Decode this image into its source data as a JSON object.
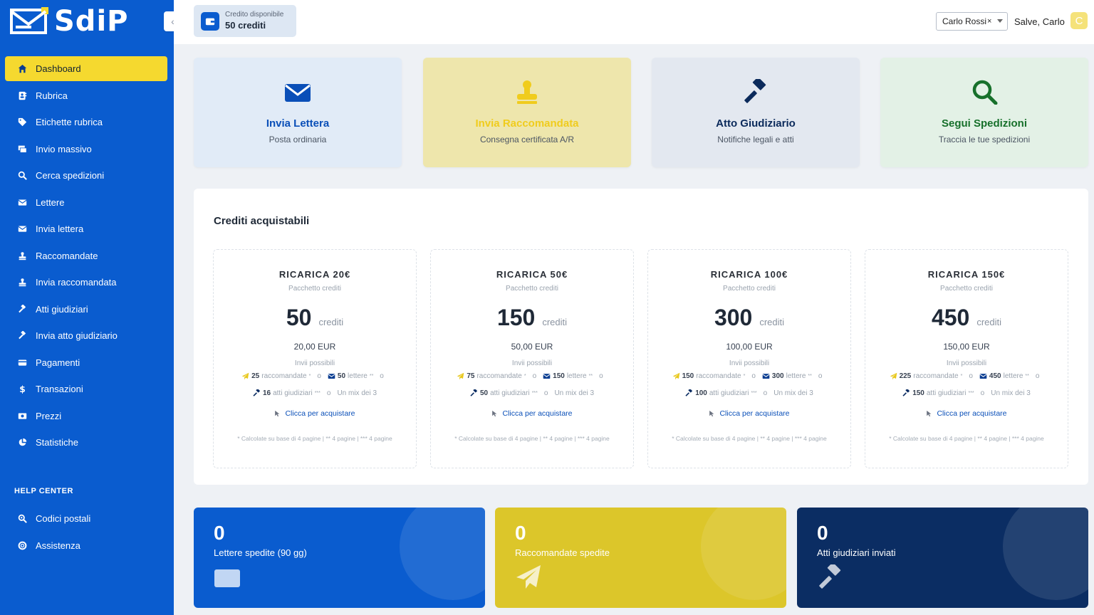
{
  "app": {
    "name": "SdiP"
  },
  "sidebar": {
    "items": [
      {
        "label": "Dashboard",
        "icon": "home-icon",
        "active": true
      },
      {
        "label": "Rubrica",
        "icon": "address-book-icon"
      },
      {
        "label": "Etichette rubrica",
        "icon": "tag-icon"
      },
      {
        "label": "Invio massivo",
        "icon": "mass-mail-icon"
      },
      {
        "label": "Cerca spedizioni",
        "icon": "search-icon"
      },
      {
        "label": "Lettere",
        "icon": "envelope-icon"
      },
      {
        "label": "Invia lettera",
        "icon": "envelope-icon"
      },
      {
        "label": "Raccomandate",
        "icon": "stamp-icon"
      },
      {
        "label": "Invia raccomandata",
        "icon": "stamp-icon"
      },
      {
        "label": "Atti giudiziari",
        "icon": "gavel-icon"
      },
      {
        "label": "Invia atto giudiziario",
        "icon": "gavel-icon"
      },
      {
        "label": "Pagamenti",
        "icon": "credit-card-icon"
      },
      {
        "label": "Transazioni",
        "icon": "dollar-icon"
      },
      {
        "label": "Prezzi",
        "icon": "money-bill-icon"
      },
      {
        "label": "Statistiche",
        "icon": "pie-chart-icon"
      }
    ],
    "help_title": "HELP CENTER",
    "help_items": [
      {
        "label": "Codici postali",
        "icon": "search-location-icon"
      },
      {
        "label": "Assistenza",
        "icon": "lifebuoy-icon"
      }
    ]
  },
  "topbar": {
    "credit_label": "Credito disponibile",
    "credit_value": "50 crediti",
    "user_select": "Carlo Rossi",
    "greeting": "Salve, Carlo",
    "avatar_initial": "C"
  },
  "actions": [
    {
      "title": "Invia Lettera",
      "subtitle": "Posta ordinaria",
      "icon": "envelope-icon",
      "bg": "#e1ebf7",
      "color": "#0a4fb8"
    },
    {
      "title": "Invia Raccomandata",
      "subtitle": "Consegna certificata A/R",
      "icon": "stamp-icon",
      "bg": "#eee6ac",
      "color": "#f0cc1d"
    },
    {
      "title": "Atto Giudiziario",
      "subtitle": "Notifiche legali e atti",
      "icon": "gavel-icon",
      "bg": "#e3e8f0",
      "color": "#0b2a5b"
    },
    {
      "title": "Segui Spedizioni",
      "subtitle": "Traccia le tue spedizioni",
      "icon": "search-icon",
      "bg": "#e3f1e6",
      "color": "#17702b"
    }
  ],
  "credits_panel": {
    "title": "Crediti acquistabili",
    "packages": [
      {
        "name": "RICARICA 20€",
        "subtitle": "Pacchetto crediti",
        "credits": "50",
        "unit": "crediti",
        "price": "20,00 EUR",
        "invii": "Invii possibili",
        "racc": "25",
        "racc_label": "raccomandate",
        "racc_sup": "*",
        "lettere": "50",
        "lettere_label": "lettere",
        "lettere_sup": "**",
        "atti": "16",
        "atti_label": "atti giudiziari",
        "atti_sup": "***",
        "or": "o",
        "mix": "Un mix dei 3",
        "buy": "Clicca per acquistare",
        "note": "* Calcolate su base di 4 pagine | ** 4 pagine | *** 4 pagine"
      },
      {
        "name": "RICARICA 50€",
        "subtitle": "Pacchetto crediti",
        "credits": "150",
        "unit": "crediti",
        "price": "50,00 EUR",
        "invii": "Invii possibili",
        "racc": "75",
        "racc_label": "raccomandate",
        "racc_sup": "*",
        "lettere": "150",
        "lettere_label": "lettere",
        "lettere_sup": "**",
        "atti": "50",
        "atti_label": "atti giudiziari",
        "atti_sup": "***",
        "or": "o",
        "mix": "Un mix dei 3",
        "buy": "Clicca per acquistare",
        "note": "* Calcolate su base di 4 pagine | ** 4 pagine | *** 4 pagine"
      },
      {
        "name": "RICARICA 100€",
        "subtitle": "Pacchetto crediti",
        "credits": "300",
        "unit": "crediti",
        "price": "100,00 EUR",
        "invii": "Invii possibili",
        "racc": "150",
        "racc_label": "raccomandate",
        "racc_sup": "*",
        "lettere": "300",
        "lettere_label": "lettere",
        "lettere_sup": "**",
        "atti": "100",
        "atti_label": "atti giudiziari",
        "atti_sup": "***",
        "or": "o",
        "mix": "Un mix dei 3",
        "buy": "Clicca per acquistare",
        "note": "* Calcolate su base di 4 pagine | ** 4 pagine | *** 4 pagine"
      },
      {
        "name": "RICARICA 150€",
        "subtitle": "Pacchetto crediti",
        "credits": "450",
        "unit": "crediti",
        "price": "150,00 EUR",
        "invii": "Invii possibili",
        "racc": "225",
        "racc_label": "raccomandate",
        "racc_sup": "*",
        "lettere": "450",
        "lettere_label": "lettere",
        "lettere_sup": "**",
        "atti": "150",
        "atti_label": "atti giudiziari",
        "atti_sup": "***",
        "or": "o",
        "mix": "Un mix dei 3",
        "buy": "Clicca per acquistare",
        "note": "* Calcolate su base di 4 pagine | ** 4 pagine | *** 4 pagine"
      }
    ]
  },
  "stats": [
    {
      "value": "0",
      "label": "Lettere spedite (90 gg)",
      "icon": "envelope-icon",
      "bg": "#0a5ccf",
      "text": "#ffffff"
    },
    {
      "value": "0",
      "label": "Raccomandate spedite",
      "icon": "paper-plane-icon",
      "bg": "#dcc62a",
      "text": "#ffffff"
    },
    {
      "value": "0",
      "label": "Atti giudiziari inviati",
      "icon": "gavel-icon",
      "bg": "#0b2d63",
      "text": "#ffffff"
    }
  ]
}
